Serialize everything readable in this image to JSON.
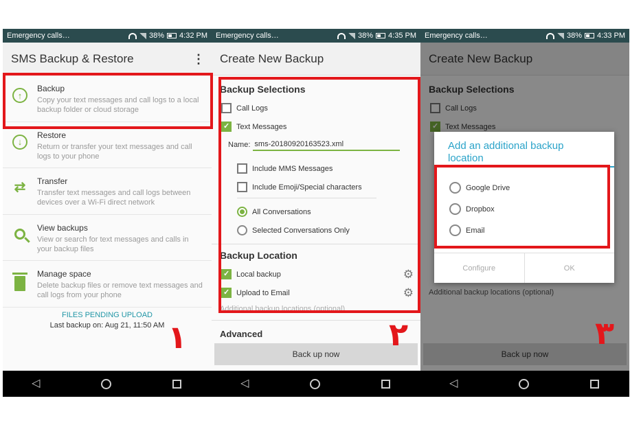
{
  "status": {
    "p1": {
      "left": "Emergency calls…",
      "battery": "38%",
      "time": "4:32 PM"
    },
    "p2": {
      "left": "Emergency calls…",
      "battery": "38%",
      "time": "4:35 PM"
    },
    "p3": {
      "left": "Emergency calls…",
      "battery": "38%",
      "time": "4:33 PM"
    }
  },
  "panel1": {
    "title": "SMS Backup & Restore",
    "menu_icon": "overflow-menu-icon",
    "items": [
      {
        "title": "Backup",
        "desc": "Copy your text messages and call logs to a local backup folder or cloud storage",
        "icon": "upload-icon"
      },
      {
        "title": "Restore",
        "desc": "Return or transfer your text messages and call logs to your phone",
        "icon": "download-icon"
      },
      {
        "title": "Transfer",
        "desc": "Transfer text messages and call logs between devices over a Wi-Fi direct network",
        "icon": "swap-icon"
      },
      {
        "title": "View backups",
        "desc": "View or search for text messages and calls in your backup files",
        "icon": "search-icon"
      },
      {
        "title": "Manage space",
        "desc": "Delete backup files or remove text messages and call logs from your phone",
        "icon": "trash-icon"
      }
    ],
    "pending": "FILES PENDING UPLOAD",
    "last_backup": "Last backup on: Aug 21, 11:50 AM",
    "step_number": "۱"
  },
  "panel2": {
    "title": "Create New Backup",
    "selections_header": "Backup Selections",
    "call_logs": "Call Logs",
    "text_messages": "Text Messages",
    "name_label": "Name:",
    "name_value": "sms-20180920163523.xml",
    "include_mms": "Include MMS Messages",
    "include_emoji": "Include Emoji/Special characters",
    "all_conversations": "All Conversations",
    "selected_conversations": "Selected Conversations Only",
    "location_header": "Backup Location",
    "local_backup": "Local backup",
    "upload_email": "Upload to Email",
    "additional_locations": "Additional backup locations (optional)",
    "advanced": "Advanced",
    "backup_button": "Back up now",
    "step_number": "۲"
  },
  "panel3": {
    "title": "Create New Backup",
    "selections_header": "Backup Selections",
    "call_logs": "Call Logs",
    "text_messages": "Text Messages",
    "additional_locations": "Additional backup locations (optional)",
    "backup_button": "Back up now",
    "dialog": {
      "title": "Add an additional backup location",
      "options": [
        "Google Drive",
        "Dropbox",
        "Email"
      ],
      "configure": "Configure",
      "ok": "OK"
    },
    "step_number": "۳"
  },
  "colors": {
    "accent": "#7cb342",
    "status_bar": "#2b4b4e",
    "highlight": "#e3171b",
    "dialog_title": "#2aa3c9"
  }
}
